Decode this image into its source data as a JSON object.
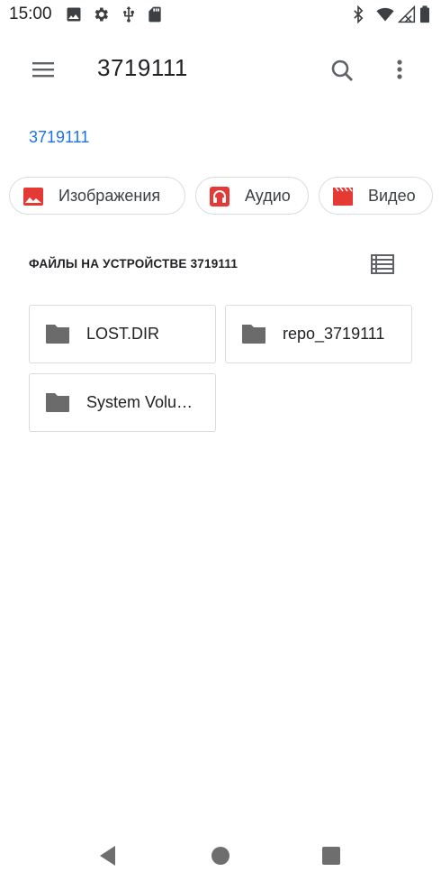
{
  "status_bar": {
    "time": "15:00",
    "left_icons": [
      "image-icon",
      "settings-gear-icon",
      "usb-icon",
      "sd-card-icon"
    ],
    "right_icons": [
      "bluetooth-icon",
      "wifi-icon",
      "signal-icon",
      "battery-icon"
    ]
  },
  "app_bar": {
    "title": "3719111",
    "menu_icon": "hamburger-menu-icon",
    "search_icon": "search-icon",
    "more_icon": "more-vert-icon"
  },
  "breadcrumb": {
    "label": "3719111"
  },
  "chips": [
    {
      "label": "Изображения",
      "icon": "image-icon",
      "color": "#e53935"
    },
    {
      "label": "Аудио",
      "icon": "headphones-icon",
      "color": "#e53935"
    },
    {
      "label": "Видео",
      "icon": "movie-icon",
      "color": "#e53935"
    }
  ],
  "section": {
    "title": "ФАЙЛЫ НА УСТРОЙСТВЕ 3719111",
    "view_icon": "list-view-icon"
  },
  "folders": [
    {
      "name": "LOST.DIR"
    },
    {
      "name": "repo_3719111"
    },
    {
      "name": "System Volume Information"
    }
  ],
  "nav_bar": {
    "icons": [
      "back-icon",
      "home-icon",
      "recents-icon"
    ]
  },
  "colors": {
    "accent": "#1a73e8",
    "icon_grey": "#5f6368",
    "folder_grey": "#6b6b6b",
    "chip_red": "#e53935"
  }
}
